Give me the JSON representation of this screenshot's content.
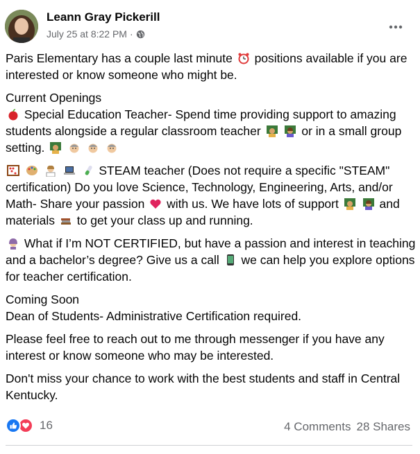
{
  "post": {
    "author": "Leann Gray Pickerill",
    "timestamp": "July 25 at 8:22 PM",
    "separator": "·",
    "privacy_icon": "globe-icon",
    "more_icon": "more-options-icon"
  },
  "content": {
    "p1_a": "Paris Elementary has a couple last minute",
    "p1_b": "positions available if you are interested or know someone who might be.",
    "openings_heading": "Current Openings",
    "sped_a": "Special Education Teacher- Spend time providing support to amazing students alongside a regular classroom teacher",
    "sped_b": "or in a small group setting.",
    "steam_a": "STEAM teacher (Does not require a specific \"STEAM\" certification) Do you love Science, Technology, Engineering, Arts, and/or Math- Share your passion",
    "steam_b": "with us. We have lots of support",
    "steam_c": "and materials",
    "steam_d": "to get your class up and running.",
    "cert_a": "What if I’m NOT CERTIFIED, but have a passion and interest in teaching and a bachelor’s degree? Give us a call",
    "cert_b": "we can help you explore options for teacher certification.",
    "coming_heading": "Coming Soon",
    "dean": "Dean of Students- Administrative Certification required.",
    "reach": "Please feel free to reach out to me through messenger if you have any interest or know someone who may be interested.",
    "closing": "Don't miss your chance to work with the best students and staff in Central Kentucky."
  },
  "footer": {
    "reaction_count": "16",
    "comments": "4 Comments",
    "shares": "28 Shares",
    "reaction_icons": [
      "like-icon",
      "love-icon"
    ]
  },
  "colors": {
    "text": "#050505",
    "secondary": "#65676b",
    "like_blue": "#1877f2",
    "love_red": "#f33e58"
  }
}
